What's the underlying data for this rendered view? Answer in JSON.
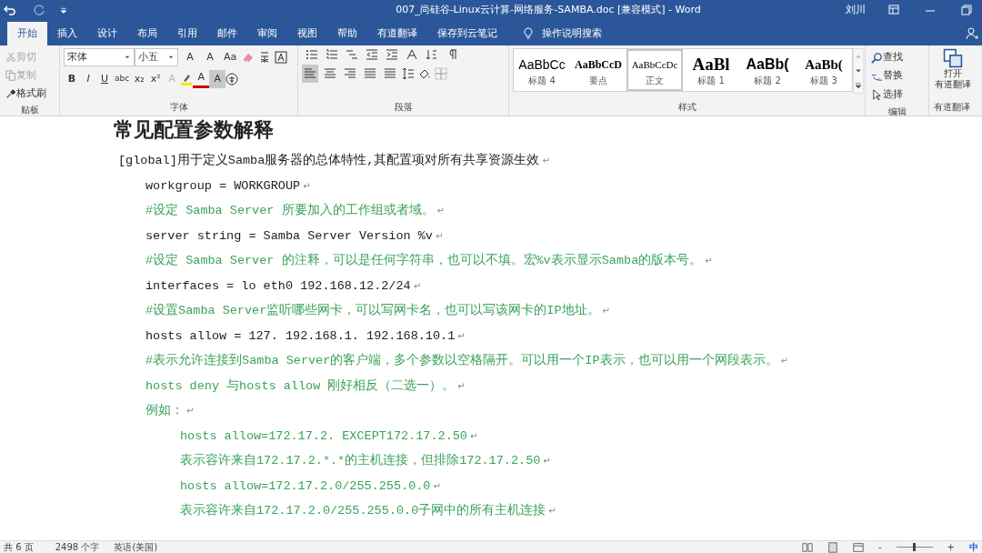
{
  "window": {
    "title": "007_尚硅谷-Linux云计算-网络服务-SAMBA.doc [兼容模式]  -  Word",
    "user": "刘川"
  },
  "tabs": [
    {
      "label": "开始",
      "selected": true
    },
    {
      "label": "插入",
      "selected": false
    },
    {
      "label": "设计",
      "selected": false
    },
    {
      "label": "布局",
      "selected": false
    },
    {
      "label": "引用",
      "selected": false
    },
    {
      "label": "邮件",
      "selected": false
    },
    {
      "label": "审阅",
      "selected": false
    },
    {
      "label": "视图",
      "selected": false
    },
    {
      "label": "帮助",
      "selected": false
    },
    {
      "label": "有道翻译",
      "selected": false
    },
    {
      "label": "保存到云笔记",
      "selected": false
    }
  ],
  "tell_me": {
    "placeholder": "操作说明搜索"
  },
  "clipboard": {
    "label": "贴板",
    "items": [
      {
        "label": "剪切",
        "disabled": true
      },
      {
        "label": "复制",
        "disabled": true
      },
      {
        "label": "格式刷",
        "disabled": false
      }
    ]
  },
  "font": {
    "label": "字体",
    "name": "宋体",
    "size": "小五",
    "grow": "A",
    "shrink": "A",
    "case": "Aa",
    "styles": [
      "B",
      "I",
      "U",
      "abc",
      "x₂",
      "x²"
    ],
    "effects": "A",
    "shade": "A",
    "font_color": "A"
  },
  "paragraph": {
    "label": "段落",
    "align": [
      {
        "selected": true
      },
      {
        "selected": false
      },
      {
        "selected": false
      },
      {
        "selected": false
      },
      {
        "selected": false
      }
    ]
  },
  "styles": {
    "label": "样式",
    "items": [
      {
        "preview": "AaBbCc",
        "name": "标题 4",
        "kind": "h4",
        "selected": false
      },
      {
        "preview": "AaBbCcD",
        "name": "要点",
        "kind": "strong",
        "selected": false
      },
      {
        "preview": "AaBbCcDc",
        "name": "正文",
        "kind": "body",
        "selected": true
      },
      {
        "preview": "AaBl",
        "name": "标题 1",
        "kind": "h1",
        "selected": false
      },
      {
        "preview": "AaBb(",
        "name": "标题 2",
        "kind": "h2",
        "selected": false
      },
      {
        "preview": "AaBb(",
        "name": "标题 3",
        "kind": "h3",
        "selected": false
      }
    ]
  },
  "editing": {
    "label": "编辑",
    "items": [
      "查找",
      "替换",
      "选择"
    ]
  },
  "youdao": {
    "button": [
      "打开",
      "有道翻译"
    ],
    "label": "有道翻译"
  },
  "document": {
    "heading": "常见配置参数解释",
    "lines": [
      {
        "kind": "intro",
        "text": "[global]用于定义Samba服务器的总体特性,其配置项对所有共享资源生效"
      },
      {
        "kind": "setting",
        "text": "workgroup = WORKGROUP"
      },
      {
        "kind": "comment",
        "text": "#设定 Samba Server 所要加入的工作组或者域。"
      },
      {
        "kind": "setting",
        "text": "server string = Samba Server Version %v"
      },
      {
        "kind": "comment",
        "text": "#设定 Samba Server 的注释，可以是任何字符串，也可以不填。宏%v表示显示Samba的版本号。"
      },
      {
        "kind": "setting",
        "text": "interfaces = lo eth0 192.168.12.2/24"
      },
      {
        "kind": "comment",
        "text": "#设置Samba Server监听哪些网卡，可以写网卡名，也可以写该网卡的IP地址。"
      },
      {
        "kind": "setting",
        "text": "hosts allow = 127. 192.168.1. 192.168.10.1"
      },
      {
        "kind": "comment",
        "text": "#表示允许连接到Samba Server的客户端，多个参数以空格隔开。可以用一个IP表示，也可以用一个网段表示。"
      },
      {
        "kind": "comment",
        "text": "hosts deny 与hosts allow 刚好相反（二选一）。"
      },
      {
        "kind": "comment",
        "text": "例如："
      },
      {
        "kind": "example",
        "text": "hosts allow=172.17.2. EXCEPT172.17.2.50"
      },
      {
        "kind": "example",
        "text": "表示容许来自172.17.2.*.*的主机连接，但排除172.17.2.50"
      },
      {
        "kind": "example",
        "text": "hosts allow=172.17.2.0/255.255.0.0"
      },
      {
        "kind": "example",
        "text": "表示容许来自172.17.2.0/255.255.0.0子网中的所有主机连接"
      }
    ],
    "mark": "↵"
  },
  "status_bar": {
    "pages": "共 6 页",
    "words": "2498 个字",
    "language": "英语(美国)",
    "ime": "中",
    "zoom_out": "-",
    "zoom_in": "+",
    "level": 0.5
  }
}
